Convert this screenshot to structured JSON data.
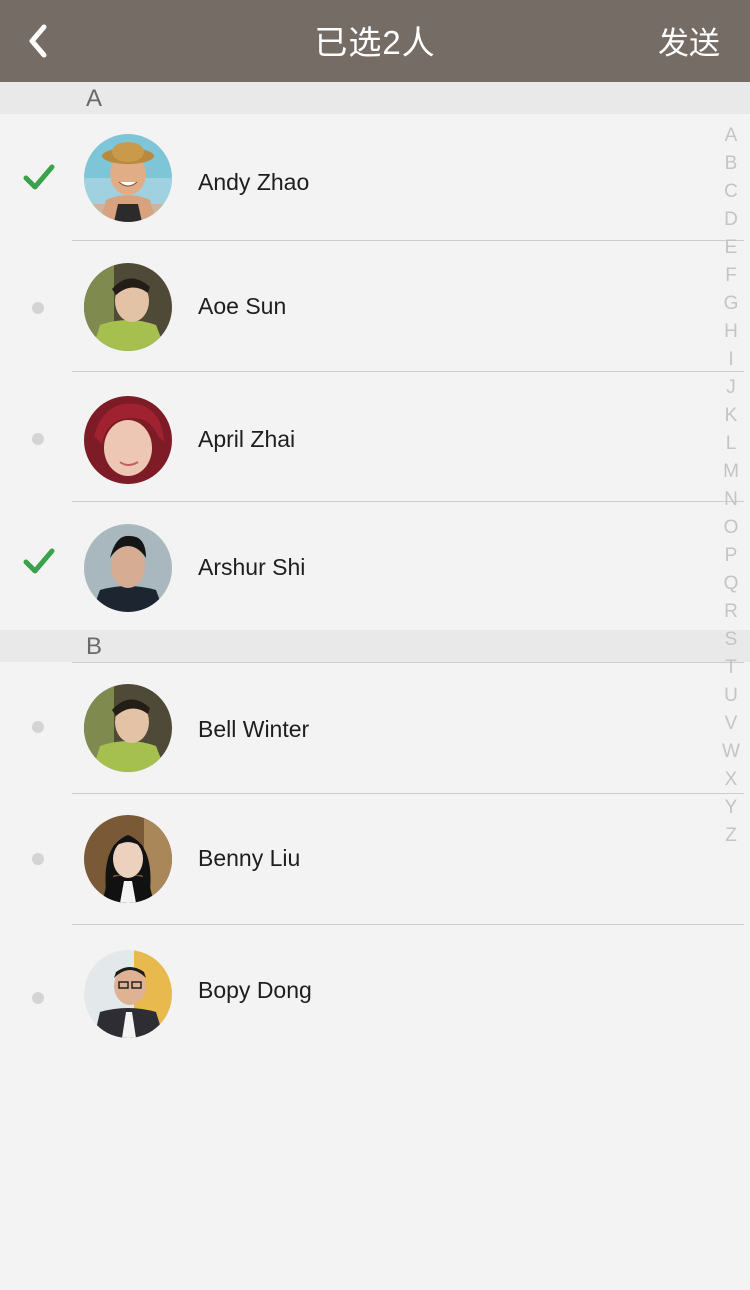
{
  "header": {
    "back_icon": "chevron-left-icon",
    "title": "已选2人",
    "send_label": "发送",
    "background_color": "#766c66"
  },
  "sections": [
    {
      "letter": "A",
      "contacts": [
        {
          "name": "Andy Zhao",
          "selected": true
        },
        {
          "name": "Aoe Sun",
          "selected": false
        },
        {
          "name": "April Zhai",
          "selected": false
        },
        {
          "name": "Arshur Shi",
          "selected": true
        }
      ]
    },
    {
      "letter": "B",
      "contacts": [
        {
          "name": "Bell Winter",
          "selected": false
        },
        {
          "name": "Benny Liu",
          "selected": false
        },
        {
          "name": "Bopy Dong",
          "selected": false
        }
      ]
    }
  ],
  "alphabet_index": [
    "A",
    "B",
    "C",
    "D",
    "E",
    "F",
    "G",
    "H",
    "I",
    "J",
    "K",
    "L",
    "M",
    "N",
    "O",
    "P",
    "Q",
    "R",
    "S",
    "T",
    "U",
    "V",
    "W",
    "X",
    "Y",
    "Z"
  ],
  "colors": {
    "check": "#3aa24a",
    "section_background": "#e9e9e9",
    "page_background": "#f3f3f3"
  }
}
